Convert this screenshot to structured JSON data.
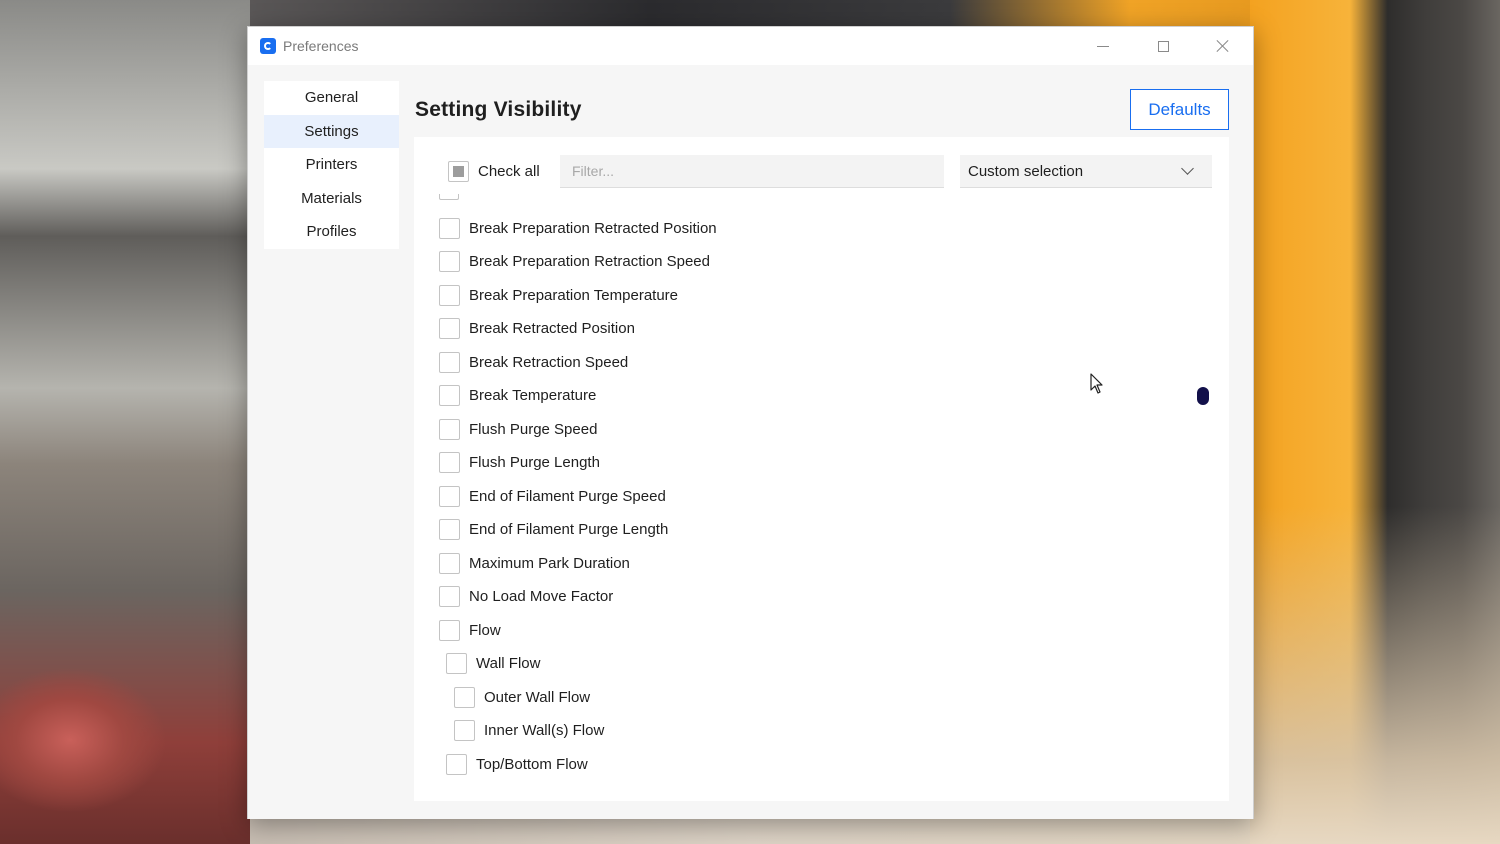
{
  "window": {
    "title": "Preferences"
  },
  "nav": {
    "items": [
      {
        "label": "General",
        "active": false
      },
      {
        "label": "Settings",
        "active": true
      },
      {
        "label": "Printers",
        "active": false
      },
      {
        "label": "Materials",
        "active": false
      },
      {
        "label": "Profiles",
        "active": false
      }
    ]
  },
  "main": {
    "heading": "Setting Visibility",
    "defaults_label": "Defaults",
    "check_all_label": "Check all",
    "filter_placeholder": "Filter...",
    "dropdown_value": "Custom selection",
    "settings": [
      {
        "label": "Break Preparation Retracted Position",
        "checked": false,
        "level": 0
      },
      {
        "label": "Break Preparation Retraction Speed",
        "checked": false,
        "level": 0
      },
      {
        "label": "Break Preparation Temperature",
        "checked": false,
        "level": 0
      },
      {
        "label": "Break Retracted Position",
        "checked": false,
        "level": 0
      },
      {
        "label": "Break Retraction Speed",
        "checked": false,
        "level": 0
      },
      {
        "label": "Break Temperature",
        "checked": false,
        "level": 0
      },
      {
        "label": "Flush Purge Speed",
        "checked": false,
        "level": 0
      },
      {
        "label": "Flush Purge Length",
        "checked": false,
        "level": 0
      },
      {
        "label": "End of Filament Purge Speed",
        "checked": false,
        "level": 0
      },
      {
        "label": "End of Filament Purge Length",
        "checked": false,
        "level": 0
      },
      {
        "label": "Maximum Park Duration",
        "checked": false,
        "level": 0
      },
      {
        "label": "No Load Move Factor",
        "checked": false,
        "level": 0
      },
      {
        "label": "Flow",
        "checked": false,
        "level": 0
      },
      {
        "label": "Wall Flow",
        "checked": false,
        "level": 1
      },
      {
        "label": "Outer Wall Flow",
        "checked": false,
        "level": 2
      },
      {
        "label": "Inner Wall(s) Flow",
        "checked": false,
        "level": 2
      },
      {
        "label": "Top/Bottom Flow",
        "checked": false,
        "level": 1
      }
    ]
  },
  "colors": {
    "accent": "#196ef0",
    "nav_active_bg": "#e8f0fd",
    "scroll_handle": "#12104a"
  }
}
